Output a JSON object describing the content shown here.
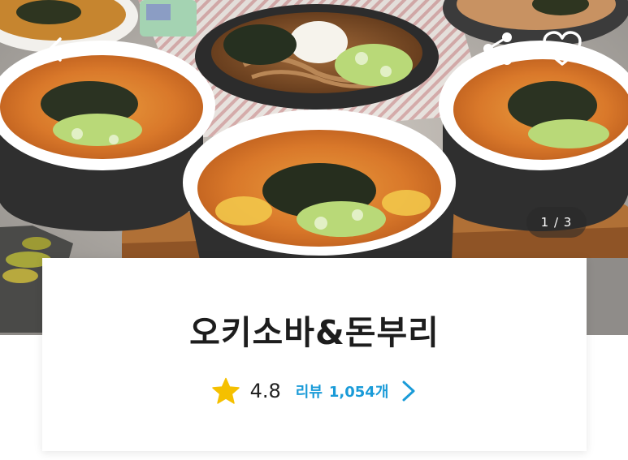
{
  "hero": {
    "pager": "1 / 3",
    "icons": {
      "back": "arrow-left-icon",
      "share": "share-icon",
      "favorite": "heart-outline-icon"
    }
  },
  "store": {
    "name": "오키소바&돈부리",
    "rating": "4.8",
    "review_label": "리뷰",
    "review_count": "1,054개"
  },
  "colors": {
    "accent_blue": "#1a9bd8",
    "star_yellow": "#f5c000",
    "title_text": "#1d1d1d"
  }
}
